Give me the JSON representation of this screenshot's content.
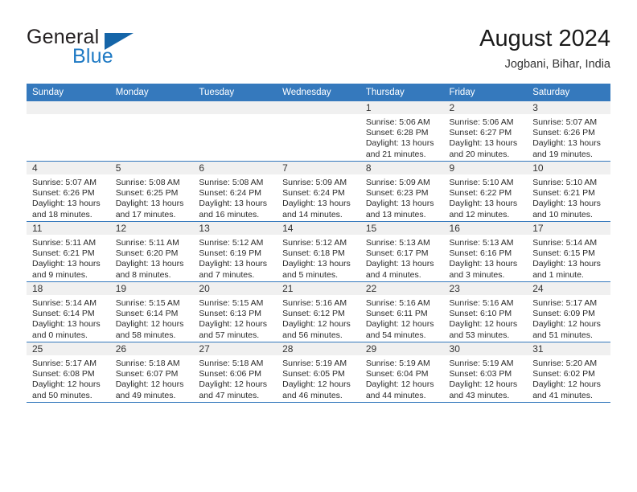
{
  "brand": {
    "name_part1": "General",
    "name_part2": "Blue",
    "flag_icon": "triangle-flag-icon"
  },
  "header": {
    "title": "August 2024",
    "location": "Jogbani, Bihar, India"
  },
  "calendar": {
    "weekday_headers": [
      "Sunday",
      "Monday",
      "Tuesday",
      "Wednesday",
      "Thursday",
      "Friday",
      "Saturday"
    ],
    "accent_color": "#3579bd",
    "band_color": "#f0f0f0",
    "weeks": [
      [
        {
          "day": "",
          "lines": []
        },
        {
          "day": "",
          "lines": []
        },
        {
          "day": "",
          "lines": []
        },
        {
          "day": "",
          "lines": []
        },
        {
          "day": "1",
          "lines": [
            "Sunrise: 5:06 AM",
            "Sunset: 6:28 PM",
            "Daylight: 13 hours",
            "and 21 minutes."
          ]
        },
        {
          "day": "2",
          "lines": [
            "Sunrise: 5:06 AM",
            "Sunset: 6:27 PM",
            "Daylight: 13 hours",
            "and 20 minutes."
          ]
        },
        {
          "day": "3",
          "lines": [
            "Sunrise: 5:07 AM",
            "Sunset: 6:26 PM",
            "Daylight: 13 hours",
            "and 19 minutes."
          ]
        }
      ],
      [
        {
          "day": "4",
          "lines": [
            "Sunrise: 5:07 AM",
            "Sunset: 6:26 PM",
            "Daylight: 13 hours",
            "and 18 minutes."
          ]
        },
        {
          "day": "5",
          "lines": [
            "Sunrise: 5:08 AM",
            "Sunset: 6:25 PM",
            "Daylight: 13 hours",
            "and 17 minutes."
          ]
        },
        {
          "day": "6",
          "lines": [
            "Sunrise: 5:08 AM",
            "Sunset: 6:24 PM",
            "Daylight: 13 hours",
            "and 16 minutes."
          ]
        },
        {
          "day": "7",
          "lines": [
            "Sunrise: 5:09 AM",
            "Sunset: 6:24 PM",
            "Daylight: 13 hours",
            "and 14 minutes."
          ]
        },
        {
          "day": "8",
          "lines": [
            "Sunrise: 5:09 AM",
            "Sunset: 6:23 PM",
            "Daylight: 13 hours",
            "and 13 minutes."
          ]
        },
        {
          "day": "9",
          "lines": [
            "Sunrise: 5:10 AM",
            "Sunset: 6:22 PM",
            "Daylight: 13 hours",
            "and 12 minutes."
          ]
        },
        {
          "day": "10",
          "lines": [
            "Sunrise: 5:10 AM",
            "Sunset: 6:21 PM",
            "Daylight: 13 hours",
            "and 10 minutes."
          ]
        }
      ],
      [
        {
          "day": "11",
          "lines": [
            "Sunrise: 5:11 AM",
            "Sunset: 6:21 PM",
            "Daylight: 13 hours",
            "and 9 minutes."
          ]
        },
        {
          "day": "12",
          "lines": [
            "Sunrise: 5:11 AM",
            "Sunset: 6:20 PM",
            "Daylight: 13 hours",
            "and 8 minutes."
          ]
        },
        {
          "day": "13",
          "lines": [
            "Sunrise: 5:12 AM",
            "Sunset: 6:19 PM",
            "Daylight: 13 hours",
            "and 7 minutes."
          ]
        },
        {
          "day": "14",
          "lines": [
            "Sunrise: 5:12 AM",
            "Sunset: 6:18 PM",
            "Daylight: 13 hours",
            "and 5 minutes."
          ]
        },
        {
          "day": "15",
          "lines": [
            "Sunrise: 5:13 AM",
            "Sunset: 6:17 PM",
            "Daylight: 13 hours",
            "and 4 minutes."
          ]
        },
        {
          "day": "16",
          "lines": [
            "Sunrise: 5:13 AM",
            "Sunset: 6:16 PM",
            "Daylight: 13 hours",
            "and 3 minutes."
          ]
        },
        {
          "day": "17",
          "lines": [
            "Sunrise: 5:14 AM",
            "Sunset: 6:15 PM",
            "Daylight: 13 hours",
            "and 1 minute."
          ]
        }
      ],
      [
        {
          "day": "18",
          "lines": [
            "Sunrise: 5:14 AM",
            "Sunset: 6:14 PM",
            "Daylight: 13 hours",
            "and 0 minutes."
          ]
        },
        {
          "day": "19",
          "lines": [
            "Sunrise: 5:15 AM",
            "Sunset: 6:14 PM",
            "Daylight: 12 hours",
            "and 58 minutes."
          ]
        },
        {
          "day": "20",
          "lines": [
            "Sunrise: 5:15 AM",
            "Sunset: 6:13 PM",
            "Daylight: 12 hours",
            "and 57 minutes."
          ]
        },
        {
          "day": "21",
          "lines": [
            "Sunrise: 5:16 AM",
            "Sunset: 6:12 PM",
            "Daylight: 12 hours",
            "and 56 minutes."
          ]
        },
        {
          "day": "22",
          "lines": [
            "Sunrise: 5:16 AM",
            "Sunset: 6:11 PM",
            "Daylight: 12 hours",
            "and 54 minutes."
          ]
        },
        {
          "day": "23",
          "lines": [
            "Sunrise: 5:16 AM",
            "Sunset: 6:10 PM",
            "Daylight: 12 hours",
            "and 53 minutes."
          ]
        },
        {
          "day": "24",
          "lines": [
            "Sunrise: 5:17 AM",
            "Sunset: 6:09 PM",
            "Daylight: 12 hours",
            "and 51 minutes."
          ]
        }
      ],
      [
        {
          "day": "25",
          "lines": [
            "Sunrise: 5:17 AM",
            "Sunset: 6:08 PM",
            "Daylight: 12 hours",
            "and 50 minutes."
          ]
        },
        {
          "day": "26",
          "lines": [
            "Sunrise: 5:18 AM",
            "Sunset: 6:07 PM",
            "Daylight: 12 hours",
            "and 49 minutes."
          ]
        },
        {
          "day": "27",
          "lines": [
            "Sunrise: 5:18 AM",
            "Sunset: 6:06 PM",
            "Daylight: 12 hours",
            "and 47 minutes."
          ]
        },
        {
          "day": "28",
          "lines": [
            "Sunrise: 5:19 AM",
            "Sunset: 6:05 PM",
            "Daylight: 12 hours",
            "and 46 minutes."
          ]
        },
        {
          "day": "29",
          "lines": [
            "Sunrise: 5:19 AM",
            "Sunset: 6:04 PM",
            "Daylight: 12 hours",
            "and 44 minutes."
          ]
        },
        {
          "day": "30",
          "lines": [
            "Sunrise: 5:19 AM",
            "Sunset: 6:03 PM",
            "Daylight: 12 hours",
            "and 43 minutes."
          ]
        },
        {
          "day": "31",
          "lines": [
            "Sunrise: 5:20 AM",
            "Sunset: 6:02 PM",
            "Daylight: 12 hours",
            "and 41 minutes."
          ]
        }
      ]
    ]
  }
}
